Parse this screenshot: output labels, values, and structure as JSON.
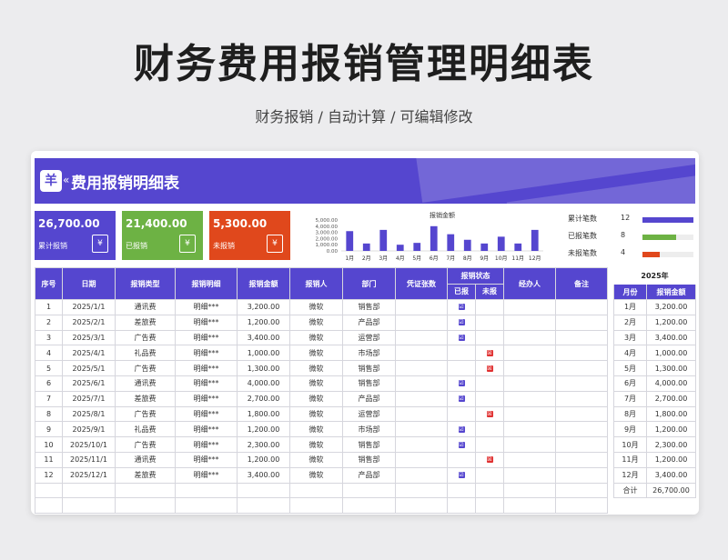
{
  "header": {
    "title": "财务费用报销管理明细表",
    "subtitle": "财务报销 / 自动计算 / 可编辑修改"
  },
  "banner": {
    "logo": "羊",
    "chevron": "«",
    "title": "费用报销明细表"
  },
  "colors": {
    "accent": "#5546cf",
    "green": "#6db244",
    "red": "#e0481c"
  },
  "stats": [
    {
      "value": "26,700.00",
      "label": "累计报销",
      "color": "#5546cf",
      "icon": "receipt-icon"
    },
    {
      "value": "21,400.00",
      "label": "已报销",
      "color": "#6db244",
      "icon": "approved-icon"
    },
    {
      "value": "5,300.00",
      "label": "未报销",
      "color": "#e0481c",
      "icon": "pending-icon"
    }
  ],
  "chart_data": {
    "type": "bar",
    "title": "报销金额",
    "categories": [
      "1月",
      "2月",
      "3月",
      "4月",
      "5月",
      "6月",
      "7月",
      "8月",
      "9月",
      "10月",
      "11月",
      "12月"
    ],
    "values": [
      3200,
      1200,
      3400,
      1000,
      1300,
      4000,
      2700,
      1800,
      1200,
      2300,
      1200,
      3400
    ],
    "yticks": [
      "5,000.00",
      "4,000.00",
      "3,000.00",
      "2,000.00",
      "1,000.00",
      "0.00"
    ],
    "ylim": [
      0,
      5000
    ],
    "color": "#5546cf"
  },
  "legend": [
    {
      "label": "累计笔数",
      "count": "12",
      "ratio": 1.0,
      "color": "#5546cf"
    },
    {
      "label": "已报笔数",
      "count": "8",
      "ratio": 0.667,
      "color": "#6db244"
    },
    {
      "label": "未报笔数",
      "count": "4",
      "ratio": 0.333,
      "color": "#e0481c"
    }
  ],
  "table": {
    "headers": [
      "序号",
      "日期",
      "报销类型",
      "报销明细",
      "报销金额",
      "报销人",
      "部门",
      "凭证张数",
      "报销状态",
      "经办人",
      "备注"
    ],
    "status_sub": [
      "已报",
      "未报"
    ],
    "rows": [
      {
        "no": "1",
        "date": "2025/1/1",
        "type": "通讯费",
        "detail": "明细***",
        "amount": "3,200.00",
        "person": "微软",
        "dept": "销售部",
        "status": "done"
      },
      {
        "no": "2",
        "date": "2025/2/1",
        "type": "差旅费",
        "detail": "明细***",
        "amount": "1,200.00",
        "person": "微软",
        "dept": "产品部",
        "status": "done"
      },
      {
        "no": "3",
        "date": "2025/3/1",
        "type": "广告费",
        "detail": "明细***",
        "amount": "3,400.00",
        "person": "微软",
        "dept": "运营部",
        "status": "done"
      },
      {
        "no": "4",
        "date": "2025/4/1",
        "type": "礼品费",
        "detail": "明细***",
        "amount": "1,000.00",
        "person": "微软",
        "dept": "市场部",
        "status": "pending"
      },
      {
        "no": "5",
        "date": "2025/5/1",
        "type": "广告费",
        "detail": "明细***",
        "amount": "1,300.00",
        "person": "微软",
        "dept": "销售部",
        "status": "pending"
      },
      {
        "no": "6",
        "date": "2025/6/1",
        "type": "通讯费",
        "detail": "明细***",
        "amount": "4,000.00",
        "person": "微软",
        "dept": "销售部",
        "status": "done"
      },
      {
        "no": "7",
        "date": "2025/7/1",
        "type": "差旅费",
        "detail": "明细***",
        "amount": "2,700.00",
        "person": "微软",
        "dept": "产品部",
        "status": "done"
      },
      {
        "no": "8",
        "date": "2025/8/1",
        "type": "广告费",
        "detail": "明细***",
        "amount": "1,800.00",
        "person": "微软",
        "dept": "运营部",
        "status": "pending"
      },
      {
        "no": "9",
        "date": "2025/9/1",
        "type": "礼品费",
        "detail": "明细***",
        "amount": "1,200.00",
        "person": "微软",
        "dept": "市场部",
        "status": "done"
      },
      {
        "no": "10",
        "date": "2025/10/1",
        "type": "广告费",
        "detail": "明细***",
        "amount": "2,300.00",
        "person": "微软",
        "dept": "销售部",
        "status": "done"
      },
      {
        "no": "11",
        "date": "2025/11/1",
        "type": "通讯费",
        "detail": "明细***",
        "amount": "1,200.00",
        "person": "微软",
        "dept": "销售部",
        "status": "pending"
      },
      {
        "no": "12",
        "date": "2025/12/1",
        "type": "差旅费",
        "detail": "明细***",
        "amount": "3,400.00",
        "person": "微软",
        "dept": "产品部",
        "status": "done"
      }
    ],
    "done_glyph": "☑",
    "pending_glyph": "☒"
  },
  "summary": {
    "year": "2025年",
    "headers": [
      "月份",
      "报销金额"
    ],
    "rows": [
      {
        "month": "1月",
        "amount": "3,200.00"
      },
      {
        "month": "2月",
        "amount": "1,200.00"
      },
      {
        "month": "3月",
        "amount": "3,400.00"
      },
      {
        "month": "4月",
        "amount": "1,000.00"
      },
      {
        "month": "5月",
        "amount": "1,300.00"
      },
      {
        "month": "6月",
        "amount": "4,000.00"
      },
      {
        "month": "7月",
        "amount": "2,700.00"
      },
      {
        "month": "8月",
        "amount": "1,800.00"
      },
      {
        "month": "9月",
        "amount": "1,200.00"
      },
      {
        "month": "10月",
        "amount": "2,300.00"
      },
      {
        "month": "11月",
        "amount": "1,200.00"
      },
      {
        "month": "12月",
        "amount": "3,400.00"
      }
    ],
    "total_label": "合计",
    "total_value": "26,700.00"
  }
}
